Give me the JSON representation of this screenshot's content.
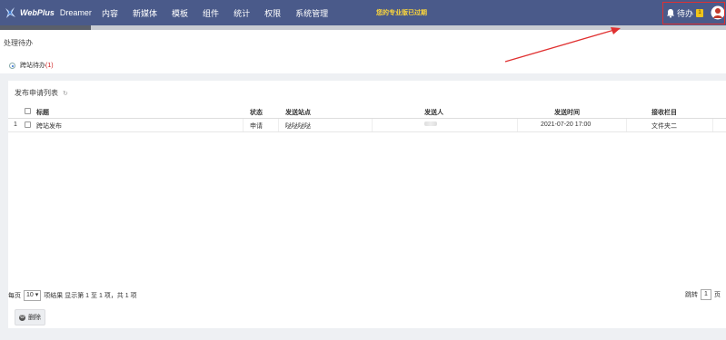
{
  "app": {
    "brand": "WebPlus",
    "product": "Dreamer"
  },
  "nav": [
    "内容",
    "新媒体",
    "模板",
    "组件",
    "统计",
    "权限",
    "系统管理"
  ],
  "notice": "您的专业版已过期",
  "todo": {
    "label": "待办",
    "count": "1"
  },
  "process_panel": {
    "title": "处理待办",
    "tab_label": "跨站待办",
    "tab_count": "(1)"
  },
  "list_panel": {
    "title": "发布申请列表",
    "refresh_icon": "↻",
    "columns": [
      "标题",
      "状态",
      "发送站点",
      "发送人",
      "发送时间",
      "接收栏目"
    ],
    "rows": [
      {
        "index": "1",
        "title": "跨站发布",
        "status": "申请",
        "site": "哒哒哒哒",
        "sender": "",
        "time": "2021-07-20 17:00",
        "column": "文件夹二"
      }
    ]
  },
  "pager": {
    "per_page_label": "每页",
    "per_page_value": "10",
    "summary": "项结果 显示第 1 至 1 项，共 1 项",
    "goto_label": "跳转",
    "goto_value": "1",
    "goto_suffix": "页"
  },
  "actions": {
    "delete_label": "删除"
  },
  "colors": {
    "topbar": "#4a5a8a",
    "notice": "#ffd83a",
    "highlight": "#e03030",
    "count_red": "#d02020"
  }
}
